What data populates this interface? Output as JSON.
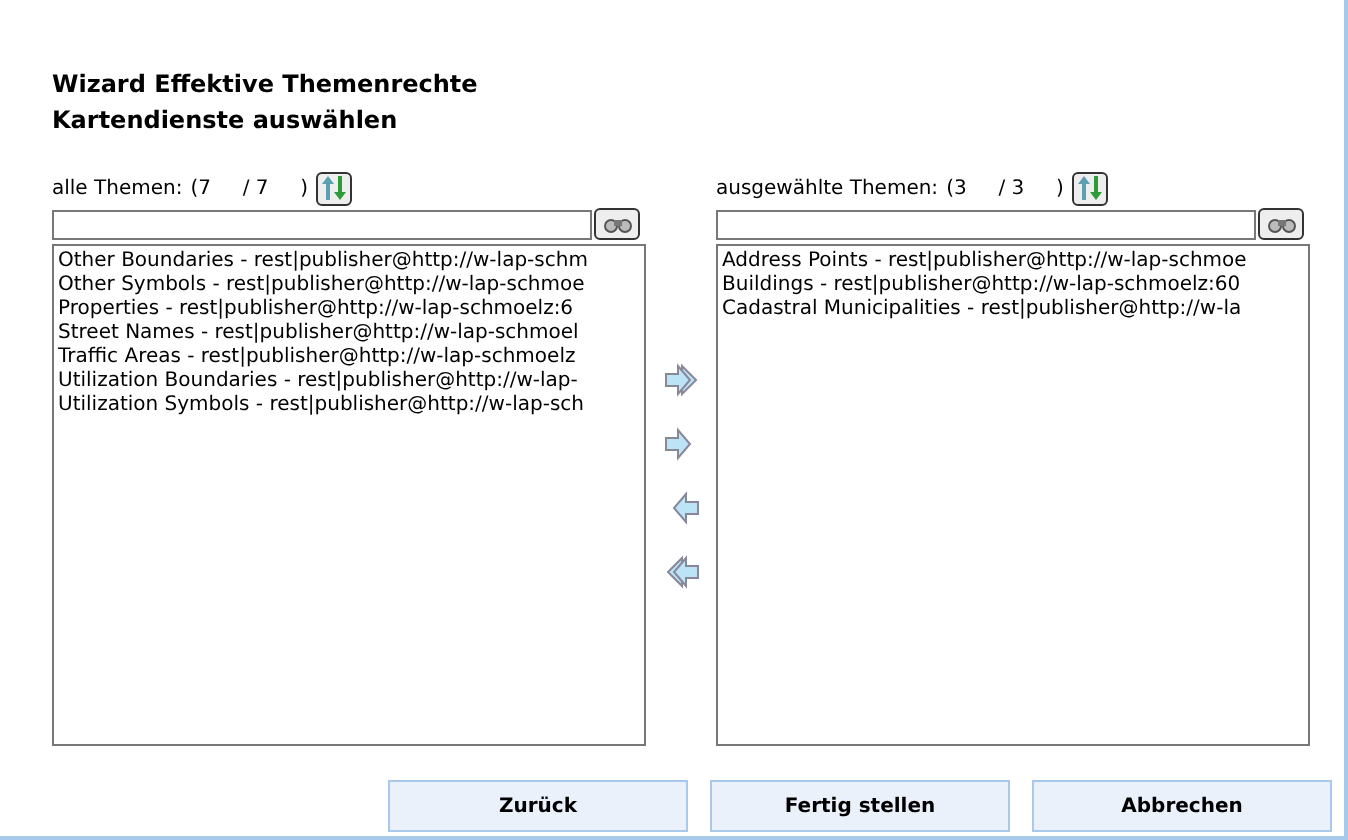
{
  "title": "Wizard Effektive Themenrechte",
  "subtitle": "Kartendienste auswählen",
  "panels": [
    {
      "label": "alle Themen:",
      "counter": "(7     / 7     )",
      "items": [
        "Other Boundaries - rest|publisher@http://w-lap-schm",
        "Other Symbols - rest|publisher@http://w-lap-schmoe",
        "Properties - rest|publisher@http://w-lap-schmoelz:6",
        "Street Names - rest|publisher@http://w-lap-schmoel",
        "Traffic Areas - rest|publisher@http://w-lap-schmoelz",
        "Utilization Boundaries - rest|publisher@http://w-lap-",
        "Utilization Symbols - rest|publisher@http://w-lap-sch"
      ]
    },
    {
      "label": "ausgewählte Themen:",
      "counter": "(3     / 3     )",
      "items": [
        "Address Points - rest|publisher@http://w-lap-schmoe",
        "Buildings - rest|publisher@http://w-lap-schmoelz:60",
        "Cadastral Municipalities - rest|publisher@http://w-la"
      ]
    }
  ],
  "buttons": [
    "Zurück",
    "Fertig stellen",
    "Abbrechen"
  ]
}
